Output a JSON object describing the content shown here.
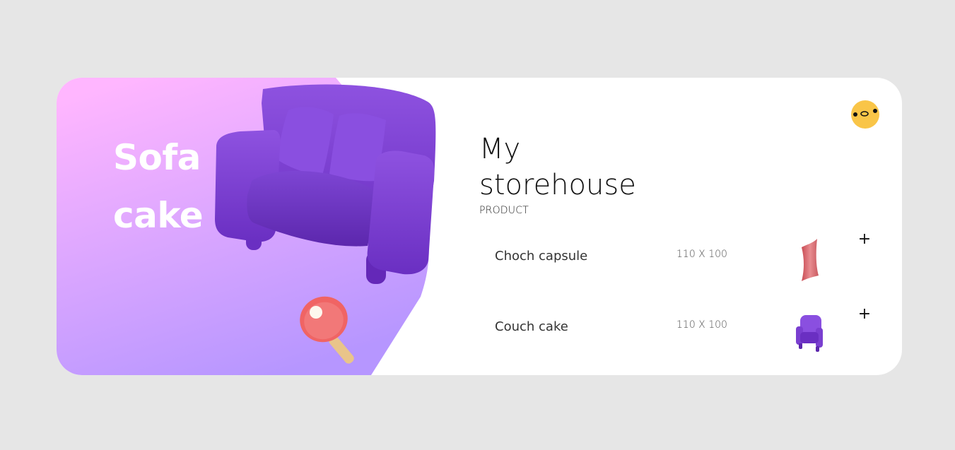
{
  "hero": {
    "title_line1": "Sofa",
    "title_line2": "cake",
    "gradient_top": "#ffb6ff",
    "gradient_bottom": "#b696ff"
  },
  "store": {
    "title_line1": "My",
    "title_line2": "storehouse",
    "section_label": "PRODUCT"
  },
  "user": {
    "avatar_icon": "emoji-face-icon",
    "avatar_color": "#f9c548"
  },
  "products": [
    {
      "name": "Choch capsule",
      "size": "110 X 100",
      "thumbnail": "pink-pillow-icon",
      "add_icon": "plus-icon",
      "add_label": "+"
    },
    {
      "name": "Couch cake",
      "size": "110 X 100",
      "thumbnail": "purple-armchair-icon",
      "add_icon": "plus-icon",
      "add_label": "+"
    }
  ],
  "colors": {
    "page_bg": "#e6e6e6",
    "card_bg": "#ffffff",
    "sofa_purple": "#7a3fd0"
  }
}
